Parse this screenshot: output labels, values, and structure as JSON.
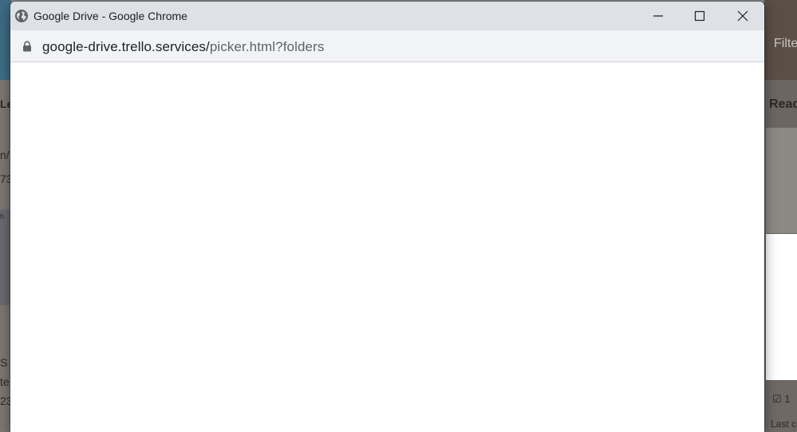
{
  "window": {
    "title": "Google Drive - Google Chrome",
    "icon": "globe-icon",
    "controls": {
      "minimize": "minimize-icon",
      "maximize": "maximize-icon",
      "close": "close-icon"
    }
  },
  "address_bar": {
    "lock_icon": "lock-icon",
    "url_host": "google-drive.trello.services/",
    "url_path": "picker.html?folders"
  },
  "background": {
    "right_filter_label": "Filte",
    "right_heading": "Read",
    "right_footer_checkbox": "☑ 1",
    "right_footer_text": "Last c",
    "left_fragments": [
      "Le",
      "n/",
      "73",
      "h",
      "S",
      "te",
      "23"
    ]
  },
  "colors": {
    "titlebar": "#dee1e6",
    "addressbar": "#f1f3f4",
    "content": "#ffffff",
    "text_primary": "#202124",
    "text_secondary": "#5f6368"
  }
}
